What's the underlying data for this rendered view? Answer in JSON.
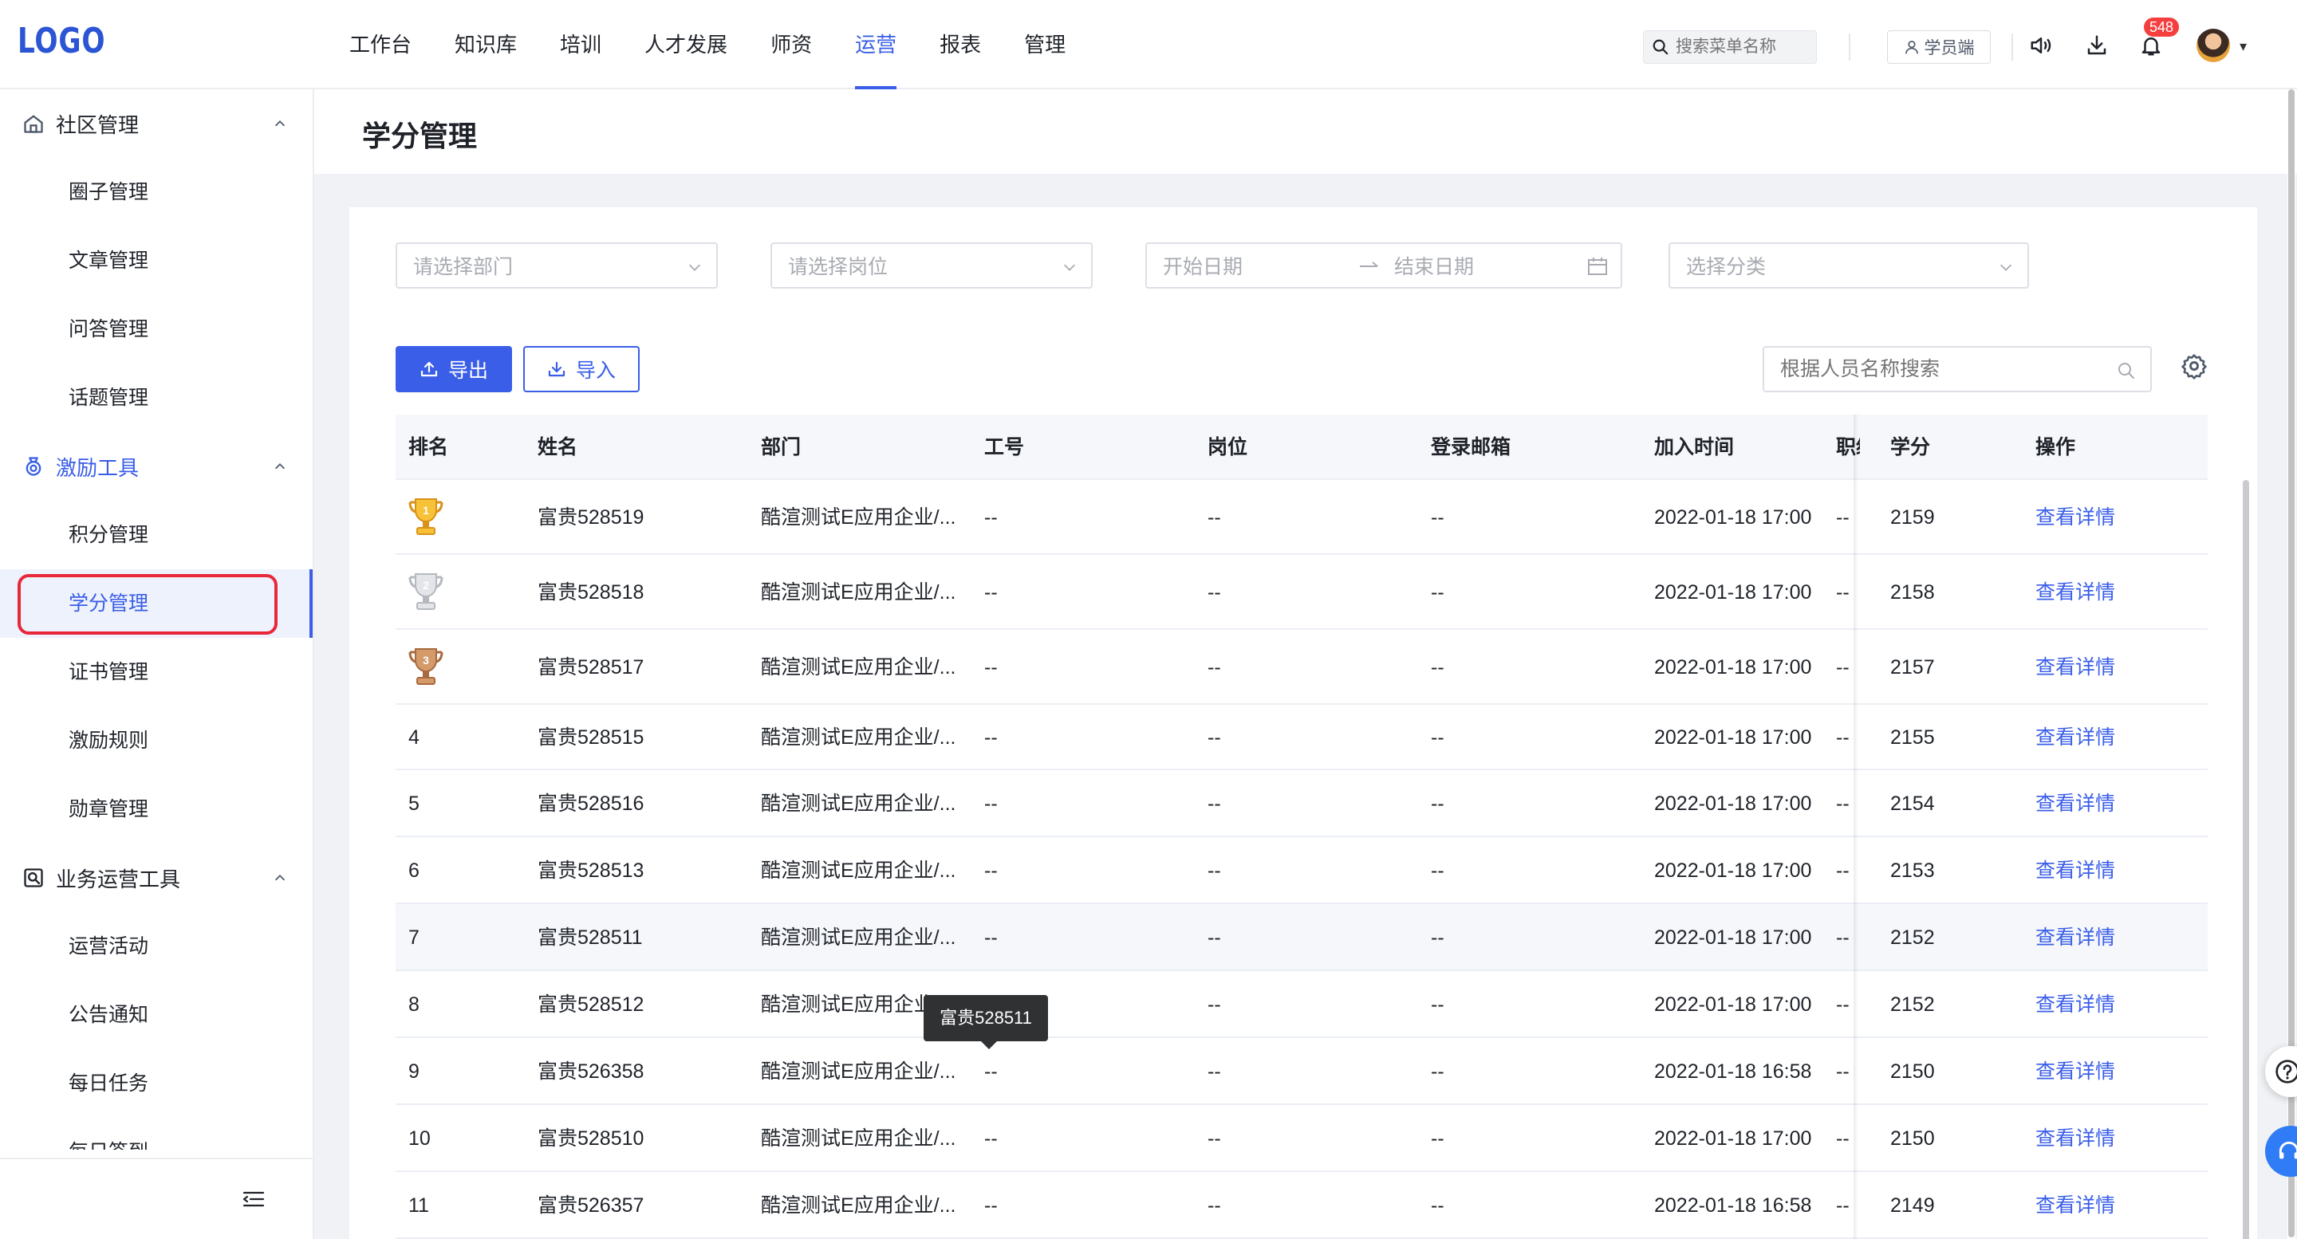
{
  "app": {
    "logo": "LOGO"
  },
  "nav": {
    "items": [
      {
        "label": "工作台",
        "name": "nav-workbench"
      },
      {
        "label": "知识库",
        "name": "nav-knowledge-base"
      },
      {
        "label": "培训",
        "name": "nav-training"
      },
      {
        "label": "人才发展",
        "name": "nav-talent-development"
      },
      {
        "label": "师资",
        "name": "nav-instructors"
      },
      {
        "label": "运营",
        "name": "nav-operations",
        "active": true
      },
      {
        "label": "报表",
        "name": "nav-reports"
      },
      {
        "label": "管理",
        "name": "nav-management"
      }
    ],
    "search_placeholder": "搜索菜单名称",
    "student_btn": "学员端",
    "notification_count": "548",
    "accent": "#3a5ee8"
  },
  "sidebar": {
    "groups": [
      {
        "label": "社区管理",
        "icon": "home-icon",
        "items": [
          "圈子管理",
          "文章管理",
          "问答管理",
          "话题管理"
        ]
      },
      {
        "label": "激励工具",
        "icon": "medal-icon",
        "active": true,
        "items": [
          "积分管理",
          "学分管理",
          "证书管理",
          "激励规则",
          "勋章管理"
        ]
      },
      {
        "label": "业务运营工具",
        "icon": "operations-icon",
        "items": [
          "运营活动",
          "公告通知",
          "每日任务",
          "每日签到"
        ]
      }
    ],
    "active_item": "学分管理",
    "highlight_color": "#e8273a"
  },
  "page": {
    "title": "学分管理"
  },
  "filters": {
    "department_placeholder": "请选择部门",
    "position_placeholder": "请选择岗位",
    "start_date_placeholder": "开始日期",
    "end_date_placeholder": "结束日期",
    "category_placeholder": "选择分类"
  },
  "toolbar": {
    "export_label": "导出",
    "import_label": "导入",
    "search_placeholder": "根据人员名称搜索"
  },
  "table": {
    "columns": [
      "排名",
      "姓名",
      "部门",
      "工号",
      "岗位",
      "登录邮箱",
      "加入时间",
      "职级",
      "学分",
      "操作"
    ],
    "rows": [
      {
        "rank": "1",
        "name": "富贵528519",
        "dept": "酷渲测试E应用企业/...",
        "id": "--",
        "position": "--",
        "email": "--",
        "joined": "2022-01-18 17:00",
        "level": "--",
        "credits": "2159",
        "action": "查看详情",
        "trophy": "gold"
      },
      {
        "rank": "2",
        "name": "富贵528518",
        "dept": "酷渲测试E应用企业/...",
        "id": "--",
        "position": "--",
        "email": "--",
        "joined": "2022-01-18 17:00",
        "level": "--",
        "credits": "2158",
        "action": "查看详情",
        "trophy": "silver"
      },
      {
        "rank": "3",
        "name": "富贵528517",
        "dept": "酷渲测试E应用企业/...",
        "id": "--",
        "position": "--",
        "email": "--",
        "joined": "2022-01-18 17:00",
        "level": "--",
        "credits": "2157",
        "action": "查看详情",
        "trophy": "bronze"
      },
      {
        "rank": "4",
        "name": "富贵528515",
        "dept": "酷渲测试E应用企业/...",
        "id": "--",
        "position": "--",
        "email": "--",
        "joined": "2022-01-18 17:00",
        "level": "--",
        "credits": "2155",
        "action": "查看详情"
      },
      {
        "rank": "5",
        "name": "富贵528516",
        "dept": "酷渲测试E应用企业/...",
        "id": "--",
        "position": "--",
        "email": "--",
        "joined": "2022-01-18 17:00",
        "level": "--",
        "credits": "2154",
        "action": "查看详情"
      },
      {
        "rank": "6",
        "name": "富贵528513",
        "dept": "酷渲测试E应用企业/...",
        "id": "--",
        "position": "--",
        "email": "--",
        "joined": "2022-01-18 17:00",
        "level": "--",
        "credits": "2153",
        "action": "查看详情"
      },
      {
        "rank": "7",
        "name": "富贵528511",
        "dept": "酷渲测试E应用企业/...",
        "id": "--",
        "position": "--",
        "email": "--",
        "joined": "2022-01-18 17:00",
        "level": "--",
        "credits": "2152",
        "action": "查看详情"
      },
      {
        "rank": "8",
        "name": "富贵528512",
        "dept": "酷渲测试E应用企业/...",
        "id": "--",
        "position": "--",
        "email": "--",
        "joined": "2022-01-18 17:00",
        "level": "--",
        "credits": "2152",
        "action": "查看详情"
      },
      {
        "rank": "9",
        "name": "富贵526358",
        "dept": "酷渲测试E应用企业/...",
        "id": "--",
        "position": "--",
        "email": "--",
        "joined": "2022-01-18 16:58",
        "level": "--",
        "credits": "2150",
        "action": "查看详情"
      },
      {
        "rank": "10",
        "name": "富贵528510",
        "dept": "酷渲测试E应用企业/...",
        "id": "--",
        "position": "--",
        "email": "--",
        "joined": "2022-01-18 17:00",
        "level": "--",
        "credits": "2150",
        "action": "查看详情"
      },
      {
        "rank": "11",
        "name": "富贵526357",
        "dept": "酷渲测试E应用企业/...",
        "id": "--",
        "position": "--",
        "email": "--",
        "joined": "2022-01-18 16:58",
        "level": "--",
        "credits": "2149",
        "action": "查看详情"
      }
    ]
  },
  "tooltip": {
    "text": "富贵528511"
  }
}
